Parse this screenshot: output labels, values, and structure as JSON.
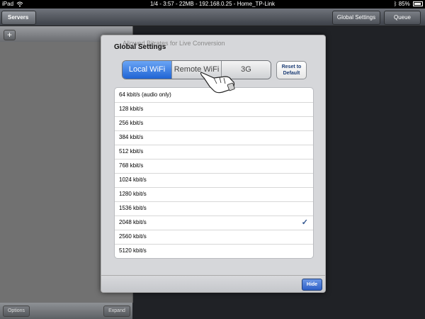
{
  "status_bar": {
    "device": "iPad",
    "center_text": "1/4 - 3:57 - 22MB - 192.168.0.25 - Home_TP-Link",
    "battery": "85%",
    "battery_level_fraction": 0.85
  },
  "navbar": {
    "back_label": "Servers",
    "global_settings_label": "Global Settings",
    "queue_label": "Queue"
  },
  "left_panel": {
    "add_label": "+",
    "options_label": "Options",
    "expand_label": "Expand"
  },
  "modal": {
    "ghost_title": "Allowed Bitrates for Live Conversion",
    "title": "Global Settings",
    "segments": [
      {
        "label": "Local WiFi",
        "active": true
      },
      {
        "label": "Remote WiFi",
        "active": false
      },
      {
        "label": "3G",
        "active": false
      }
    ],
    "reset_label_line1": "Reset to",
    "reset_label_line2": "Default",
    "bitrates": [
      {
        "label": "64 kbit/s (audio only)",
        "checked": false
      },
      {
        "label": "128 kbit/s",
        "checked": false
      },
      {
        "label": "256 kbit/s",
        "checked": false
      },
      {
        "label": "384 kbit/s",
        "checked": false
      },
      {
        "label": "512 kbit/s",
        "checked": false
      },
      {
        "label": "768 kbit/s",
        "checked": false
      },
      {
        "label": "1024 kbit/s",
        "checked": false
      },
      {
        "label": "1280 kbit/s",
        "checked": false
      },
      {
        "label": "1536 kbit/s",
        "checked": false
      },
      {
        "label": "2048 kbit/s",
        "checked": true
      },
      {
        "label": "2560 kbit/s",
        "checked": false
      },
      {
        "label": "5120 kbit/s",
        "checked": false
      }
    ],
    "check_glyph": "✓",
    "hide_label": "Hide"
  }
}
